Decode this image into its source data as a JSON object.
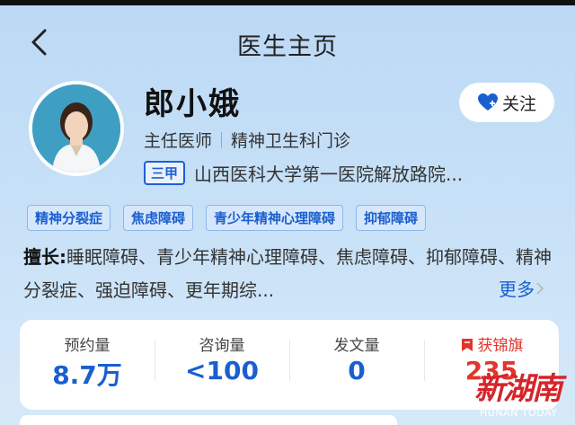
{
  "header": {
    "title": "医生主页"
  },
  "doctor": {
    "name": "郎小娥",
    "title": "主任医师",
    "department": "精神卫生科门诊",
    "grade": "三甲",
    "hospital": "山西医科大学第一医院解放路院..."
  },
  "follow": {
    "label": "关注"
  },
  "tags": [
    "精神分裂症",
    "焦虑障碍",
    "青少年精神心理障碍",
    "抑郁障碍"
  ],
  "skills": {
    "label": "擅长:",
    "text": "睡眠障碍、青少年精神心理障碍、焦虑障碍、抑郁障碍、精神分裂症、强迫障碍、更年期综...",
    "more": "更多"
  },
  "stats": [
    {
      "label": "预约量",
      "value": "8.7万"
    },
    {
      "label": "咨询量",
      "value": "<100"
    },
    {
      "label": "发文量",
      "value": "0"
    },
    {
      "label": "获锦旗",
      "value": "235"
    }
  ],
  "watermark": {
    "logo": "新湖南",
    "sub": "HUNAN TODAY"
  },
  "colors": {
    "accent": "#1a5fd0",
    "award": "#e2352b",
    "background": "#c4def6"
  }
}
